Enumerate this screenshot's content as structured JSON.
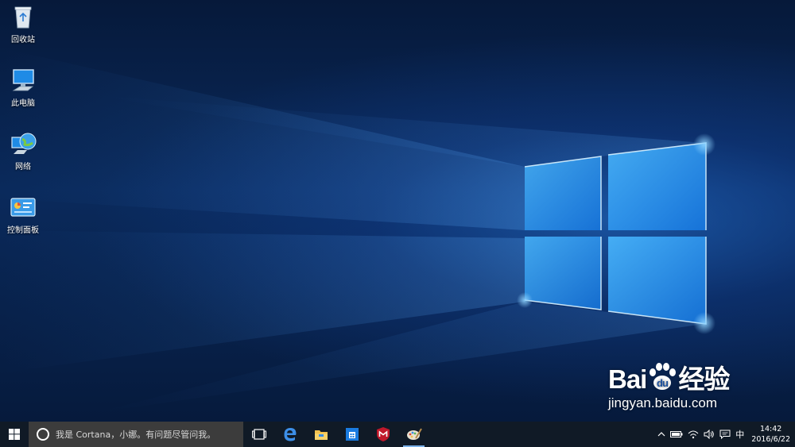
{
  "desktop": {
    "icons": [
      {
        "label": "回收站",
        "icon": "recycle-bin-icon"
      },
      {
        "label": "此电脑",
        "icon": "computer-icon"
      },
      {
        "label": "网络",
        "icon": "network-icon"
      },
      {
        "label": "控制面板",
        "icon": "control-panel-icon"
      }
    ]
  },
  "watermark": {
    "brand_prefix": "Bai",
    "brand_suffix": "经验",
    "url": "jingyan.baidu.com"
  },
  "taskbar": {
    "search_placeholder": "我是 Cortana，小娜。有问题尽管问我。",
    "pinned": [
      "task-view-icon",
      "edge-icon",
      "file-explorer-icon",
      "store-icon",
      "mcafee-icon",
      "paint-icon"
    ],
    "ime": "中",
    "time": "14:42",
    "date": "2016/6/22",
    "accent_color": "#7ab0e8"
  }
}
